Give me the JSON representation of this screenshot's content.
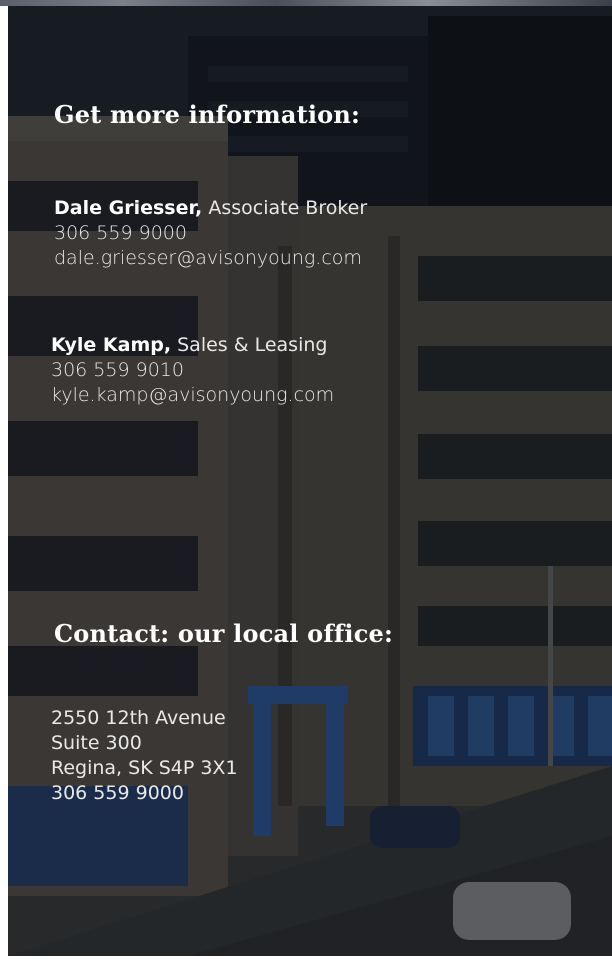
{
  "sections": {
    "info_title": "Get more information:",
    "office_title": "Contact: our local office:"
  },
  "contacts": [
    {
      "name": "Dale Griesser,",
      "role": "Associate Broker",
      "phone": "306 559 9000",
      "email": "dale.griesser@avisonyoung.com"
    },
    {
      "name": "Kyle Kamp,",
      "role": "Sales & Leasing",
      "phone": "306 559 9010",
      "email": "kyle.kamp@avisonyoung.com"
    }
  ],
  "office": {
    "street": "2550 12th Avenue",
    "suite": "Suite 300",
    "city": "Regina, SK  S4P 3X1",
    "phone": "306 559 9000"
  }
}
